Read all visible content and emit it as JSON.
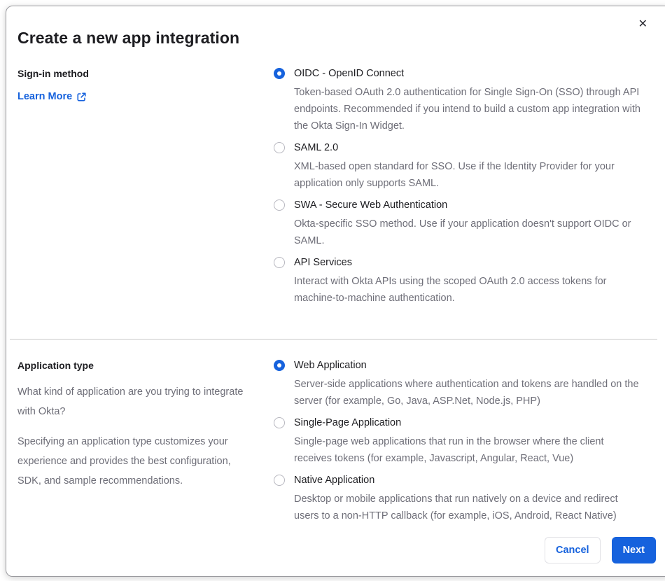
{
  "modal": {
    "title": "Create a new app integration",
    "close_glyph": "✕"
  },
  "signin_section": {
    "label": "Sign-in method",
    "learn_more_label": "Learn More",
    "options": [
      {
        "title": "OIDC - OpenID Connect",
        "description": "Token-based OAuth 2.0 authentication for Single Sign-On (SSO) through API endpoints. Recommended if you intend to build a custom app integration with the Okta Sign-In Widget.",
        "selected": true
      },
      {
        "title": "SAML 2.0",
        "description": "XML-based open standard for SSO. Use if the Identity Provider for your application only supports SAML.",
        "selected": false
      },
      {
        "title": "SWA - Secure Web Authentication",
        "description": "Okta-specific SSO method. Use if your application doesn't support OIDC or SAML.",
        "selected": false
      },
      {
        "title": "API Services",
        "description": "Interact with Okta APIs using the scoped OAuth 2.0 access tokens for machine-to-machine authentication.",
        "selected": false
      }
    ]
  },
  "apptype_section": {
    "label": "Application type",
    "description_1": "What kind of application are you trying to integrate with Okta?",
    "description_2": "Specifying an application type customizes your experience and provides the best configuration, SDK, and sample recommendations.",
    "options": [
      {
        "title": "Web Application",
        "description": "Server-side applications where authentication and tokens are handled on the server (for example, Go, Java, ASP.Net, Node.js, PHP)",
        "selected": true
      },
      {
        "title": "Single-Page Application",
        "description": "Single-page web applications that run in the browser where the client receives tokens (for example, Javascript, Angular, React, Vue)",
        "selected": false
      },
      {
        "title": "Native Application",
        "description": "Desktop or mobile applications that run natively on a device and redirect users to a non-HTTP callback (for example, iOS, Android, React Native)",
        "selected": false
      }
    ]
  },
  "footer": {
    "cancel_label": "Cancel",
    "next_label": "Next"
  },
  "colors": {
    "accent_blue": "#1662dd",
    "title_text": "#1d1d21",
    "body_text": "#6e6e78",
    "divider": "#c8c8c8"
  }
}
